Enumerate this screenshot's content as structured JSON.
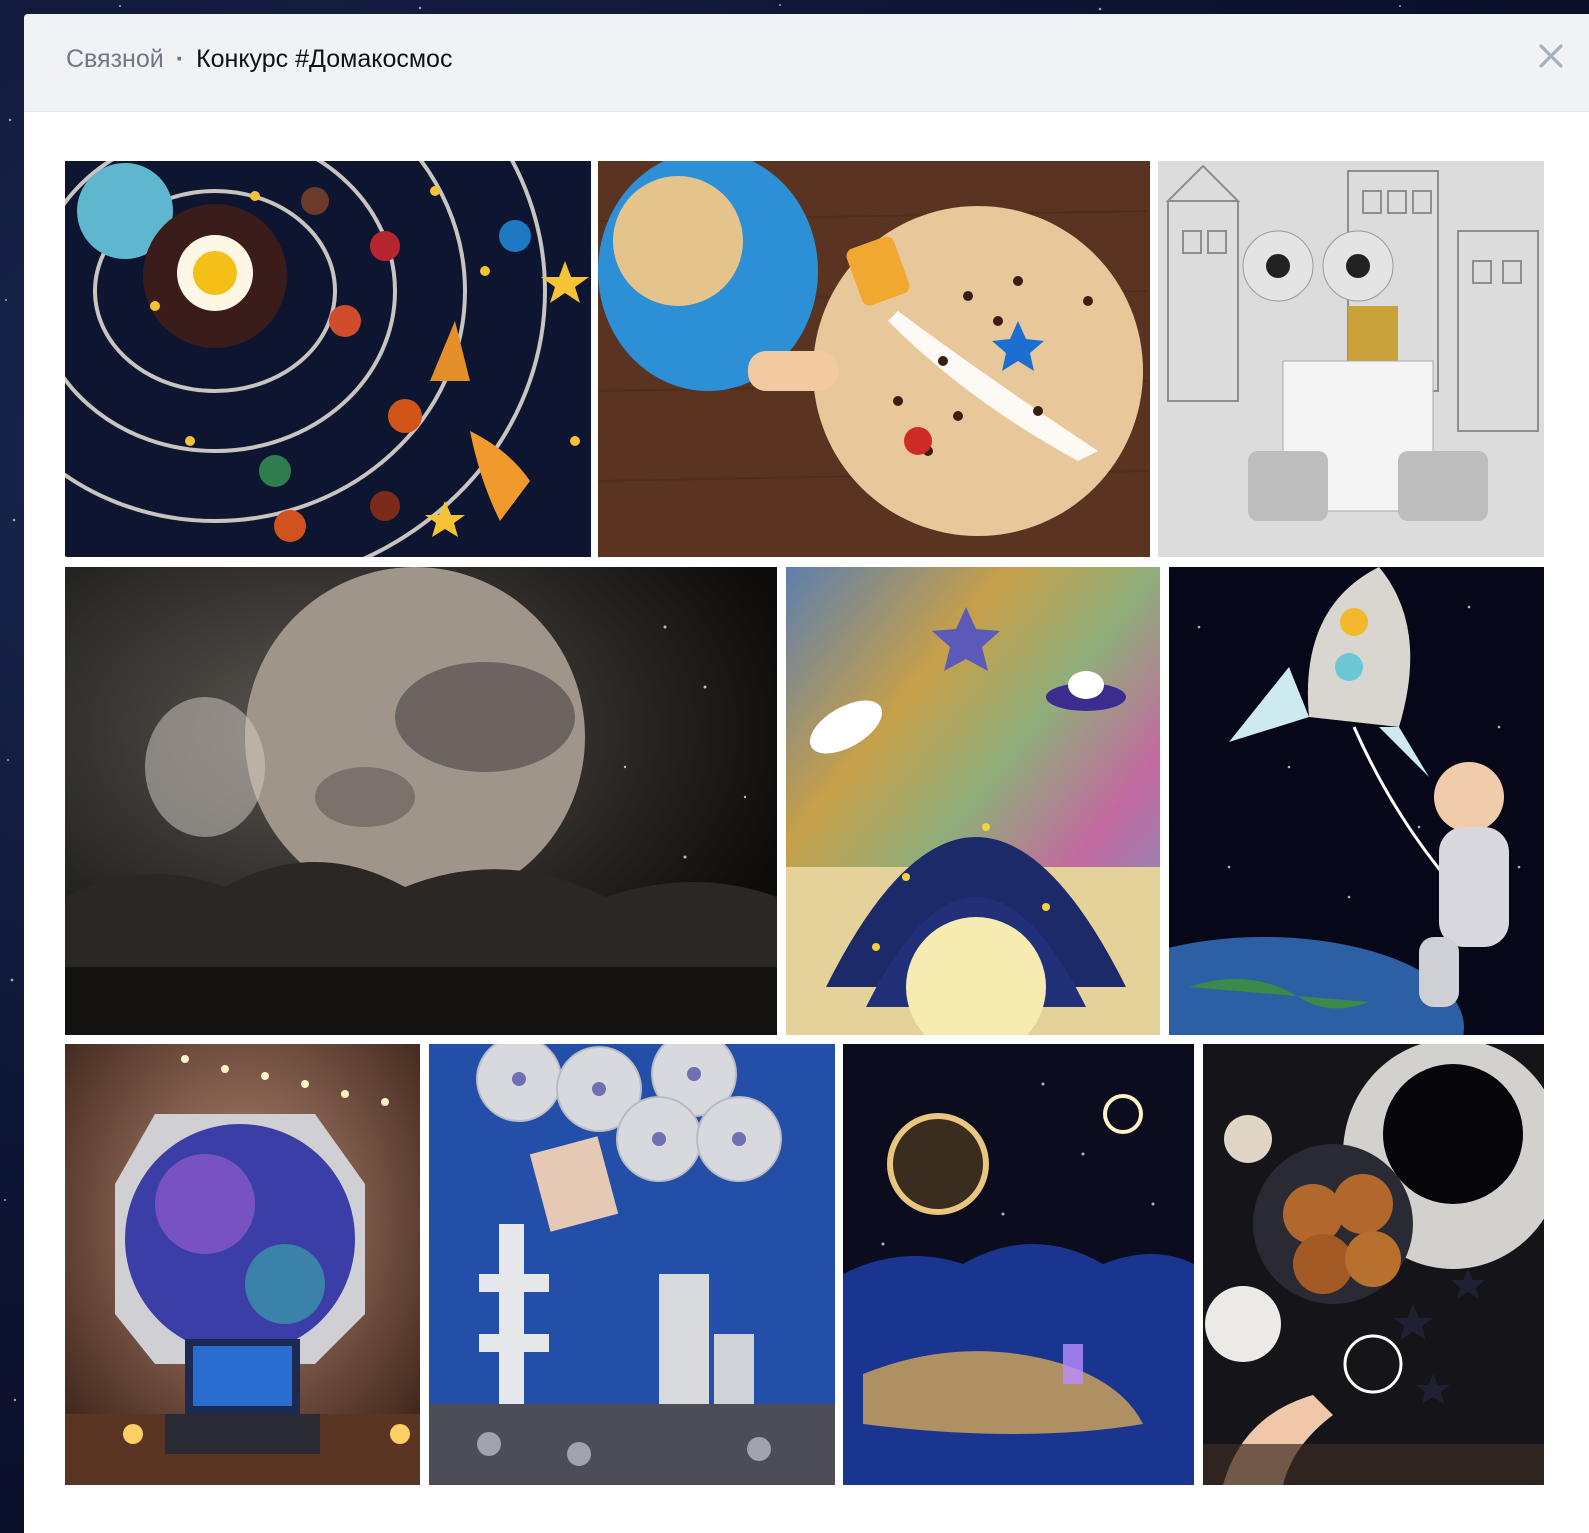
{
  "header": {
    "group_name": "Связной",
    "separator": "·",
    "album_title": "Конкурс #Домакосмос"
  },
  "close_icon": "close-icon",
  "colors": {
    "header_bg": "#f0f2f5",
    "group_text": "#6f7985",
    "title_text": "#111111",
    "page_bg": "#0e1636"
  },
  "photos": [
    {
      "name": "photo-solar-system-food"
    },
    {
      "name": "photo-child-table-space"
    },
    {
      "name": "photo-cardboard-robot"
    },
    {
      "name": "photo-moon-painting"
    },
    {
      "name": "photo-felt-planet-craft"
    },
    {
      "name": "photo-rocket-astronaut-child"
    },
    {
      "name": "photo-porthole-laptop"
    },
    {
      "name": "photo-cd-space-collage"
    },
    {
      "name": "photo-glowing-planets"
    },
    {
      "name": "photo-donuts-eclipse"
    }
  ]
}
